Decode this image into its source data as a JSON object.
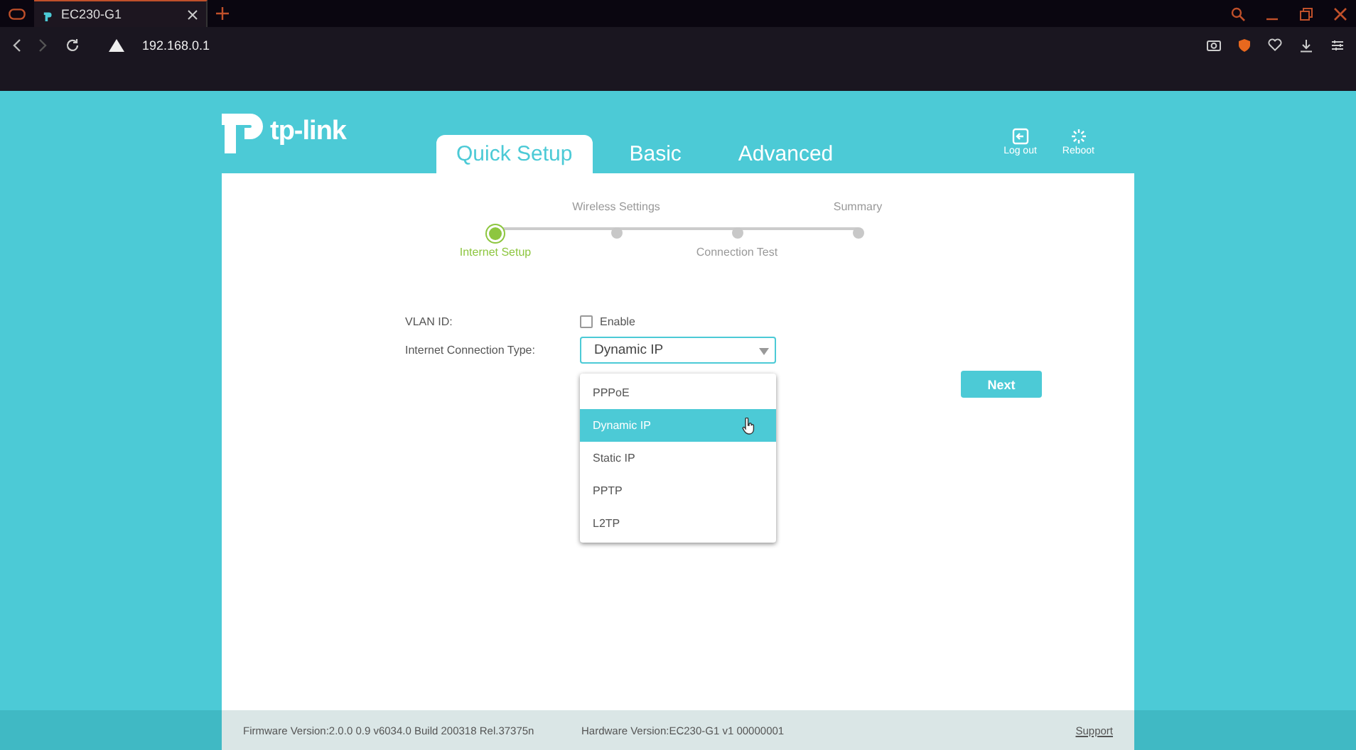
{
  "browser": {
    "tabs": [
      {
        "title": "EC230-G1",
        "selected": true
      }
    ],
    "address": "192.168.0.1"
  },
  "header": {
    "logo": "tp-link",
    "nav": [
      {
        "label": "Quick Setup",
        "selected": true
      },
      {
        "label": "Basic",
        "selected": false
      },
      {
        "label": "Advanced",
        "selected": false
      }
    ],
    "actions": [
      {
        "kind": "logout",
        "label": "Log out"
      },
      {
        "kind": "reboot",
        "label": "Reboot"
      }
    ]
  },
  "steps": [
    {
      "label": "Internet Setup",
      "selected": true
    },
    {
      "label": "Wireless Settings",
      "selected": false
    },
    {
      "label": "Connection Test",
      "selected": false
    },
    {
      "label": "Summary",
      "selected": false
    }
  ],
  "form": {
    "vlan": {
      "label": "VLAN ID:",
      "option": "Enable",
      "checked": false
    },
    "connection": {
      "label": "Internet Connection Type:",
      "value": "Dynamic IP",
      "options": [
        {
          "label": "PPPoE",
          "selected": false
        },
        {
          "label": "Dynamic IP",
          "selected": true
        },
        {
          "label": "Static IP",
          "selected": false
        },
        {
          "label": "PPTP",
          "selected": false
        },
        {
          "label": "L2TP",
          "selected": false
        }
      ]
    },
    "next": "Next"
  },
  "footer": {
    "firmware": "Firmware Version:2.0.0 0.9 v6034.0 Build 200318 Rel.37375n",
    "hardware": "Hardware Version:EC230-G1 v1 00000001",
    "support": "Support"
  }
}
